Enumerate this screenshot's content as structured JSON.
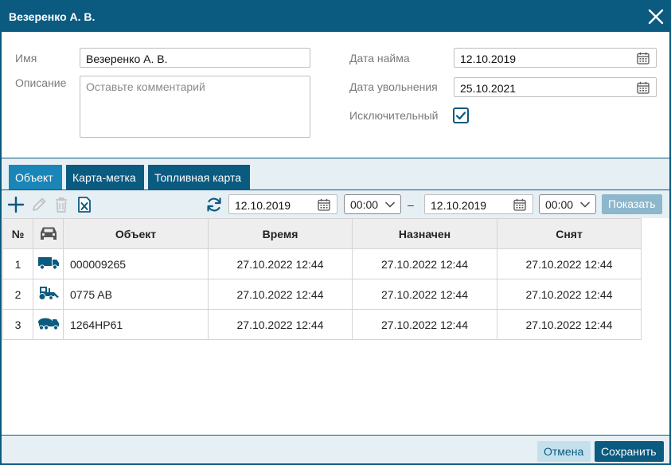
{
  "dialog": {
    "title": "Везеренко А. В."
  },
  "form": {
    "name_label": "Имя",
    "name_value": "Везеренко А. В.",
    "description_label": "Описание",
    "description_placeholder": "Оставьте комментарий",
    "hire_date_label": "Дата найма",
    "hire_date_value": "12.10.2019",
    "dismissal_date_label": "Дата увольнения",
    "dismissal_date_value": "25.10.2021",
    "exclusive_label": "Исключительный",
    "exclusive_checked": true
  },
  "tabs": [
    {
      "label": "Объект",
      "active": true
    },
    {
      "label": "Карта-метка",
      "active": false
    },
    {
      "label": "Топливная карта",
      "active": false
    }
  ],
  "toolbar": {
    "date_from": "12.10.2019",
    "time_from": "00:00",
    "separator": "–",
    "date_to": "12.10.2019",
    "time_to": "00:00",
    "show_label": "Показать"
  },
  "table": {
    "columns": [
      "№",
      "",
      "Объект",
      "Время",
      "Назначен",
      "Снят"
    ],
    "rows": [
      {
        "num": "1",
        "icon": "truck-icon",
        "object": "000009265",
        "time": "27.10.2022 12:44",
        "assigned": "27.10.2022 12:44",
        "removed": "27.10.2022 12:44"
      },
      {
        "num": "2",
        "icon": "tractor-icon",
        "object": "0775 AB",
        "time": "27.10.2022 12:44",
        "assigned": "27.10.2022 12:44",
        "removed": "27.10.2022 12:44"
      },
      {
        "num": "3",
        "icon": "mixer-truck-icon",
        "object": "1264HP61",
        "time": "27.10.2022 12:44",
        "assigned": "27.10.2022 12:44",
        "removed": "27.10.2022 12:44"
      }
    ]
  },
  "footer": {
    "cancel_label": "Отмена",
    "save_label": "Сохранить"
  },
  "colors": {
    "primary": "#0b5a80",
    "tab_active": "#1a86b8",
    "panel_bg": "#e6eff4",
    "show_button": "#8db7cc",
    "cancel_button": "#c4e0ec"
  }
}
